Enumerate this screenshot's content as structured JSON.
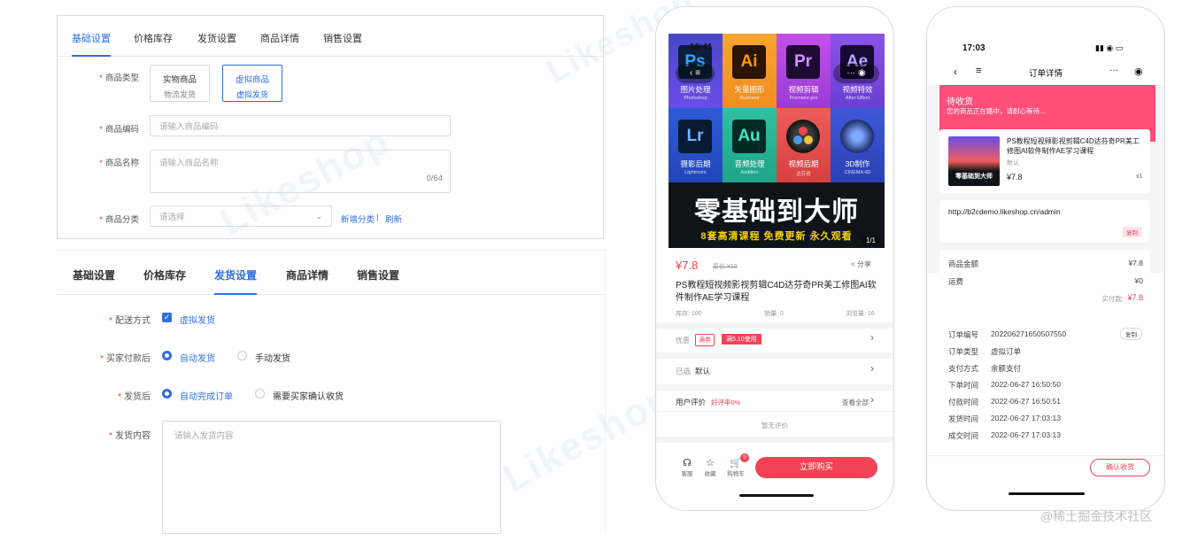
{
  "admin_top": {
    "tabs": [
      "基础设置",
      "价格库存",
      "发货设置",
      "商品详情",
      "销售设置"
    ],
    "fields": {
      "type_label": "商品类型",
      "type_options": [
        {
          "title": "实物商品",
          "sub": "物流发货"
        },
        {
          "title": "虚拟商品",
          "sub": "虚拟发货"
        }
      ],
      "code_label": "商品编码",
      "code_placeholder": "请输入商品编码",
      "name_label": "商品名称",
      "name_placeholder": "请输入商品名称",
      "name_count": "0/64",
      "category_label": "商品分类",
      "category_placeholder": "请选择",
      "add_category": "新增分类",
      "separator": "|",
      "refresh": "刷新"
    }
  },
  "admin_bottom": {
    "tabs": [
      "基础设置",
      "价格库存",
      "发货设置",
      "商品详情",
      "销售设置"
    ],
    "fields": {
      "delivery_label": "配送方式",
      "delivery_option": "虚拟发货",
      "after_pay_label": "买家付款后",
      "after_pay_options": [
        "自动发货",
        "手动发货"
      ],
      "after_ship_label": "发货后",
      "after_ship_options": [
        "自动完成订单",
        "需要买家确认收货"
      ],
      "content_label": "发货内容",
      "content_placeholder": "请输入发货内容"
    }
  },
  "watermark": "Likeshop",
  "phone1": {
    "status_time": "16:41",
    "grid": [
      {
        "abbr": "Ps",
        "title": "图片处理",
        "sub": "Photoshop"
      },
      {
        "abbr": "Ai",
        "title": "矢量图形",
        "sub": "Illustrator"
      },
      {
        "abbr": "Pr",
        "title": "视频剪辑",
        "sub": "Premiere pro"
      },
      {
        "abbr": "Ae",
        "title": "视频特效",
        "sub": "After Effect"
      },
      {
        "abbr": "Lr",
        "title": "摄影后期",
        "sub": "Lightroom"
      },
      {
        "abbr": "Au",
        "title": "音频处理",
        "sub": "Audition"
      },
      {
        "abbr": "",
        "title": "视频后期",
        "sub": "达芬奇"
      },
      {
        "abbr": "",
        "title": "3D制作",
        "sub": "CINEMA 4D"
      }
    ],
    "banner_title": "零基础到大师",
    "banner_sub": "8套高清课程  免费更新  永久观看",
    "banner_page": "1/1",
    "price": "¥7.8",
    "price_orig": "原价 ¥10",
    "share": "分享",
    "product_title": "PS教程短视频影视剪辑C4D达芬奇PR美工修图AI软件制作AE学习课程",
    "stock": "库存: 100",
    "sales": "销量: 0",
    "views": "浏览量: 16",
    "promo_label": "优惠",
    "promo_tag": "满券",
    "promo_coupon": "满5.10使用",
    "selected_label": "已选",
    "selected_value": "默认",
    "review_label": "用户评价",
    "review_rate": "好评率0%",
    "review_all": "查看全部",
    "no_review": "暂无评价",
    "nav": [
      {
        "icon": "headset-icon",
        "label": "客服"
      },
      {
        "icon": "star-icon",
        "label": "收藏"
      },
      {
        "icon": "cart-icon",
        "label": "购物车"
      }
    ],
    "cart_badge": "0",
    "buy_button": "立即购买"
  },
  "phone2": {
    "status_time": "17:03",
    "title": "订单详情",
    "status_title": "待收货",
    "status_sub": "您的商品正在路中，请耐心等待...",
    "item_title": "PS教程短视频影视剪辑C4D达芬奇PR美工修图AI软件制作AE学习课程",
    "item_spec": "默认",
    "item_price": "¥7.8",
    "item_qty": "x1",
    "item_thumb_text": "零基础到大师",
    "link": "http://b2cdemo.likeshop.cn/admin",
    "copy_btn": "复制",
    "goods_total_label": "商品金额",
    "goods_total": "¥7.8",
    "freight_label": "运费",
    "freight": "¥0",
    "paid_label": "实付款:",
    "paid": "¥7.8",
    "order_rows": [
      {
        "label": "订单编号",
        "value": "202206271650507550"
      },
      {
        "label": "订单类型",
        "value": "虚拟订单"
      },
      {
        "label": "支付方式",
        "value": "余额支付"
      },
      {
        "label": "下单时间",
        "value": "2022-06-27 16:50:50"
      },
      {
        "label": "付款时间",
        "value": "2022-06-27 16:50:51"
      },
      {
        "label": "发货时间",
        "value": "2022-06-27 17:03:13"
      },
      {
        "label": "成交时间",
        "value": "2022-06-27 17:03:13"
      }
    ],
    "copy_btn2": "复制",
    "confirm_button": "确认收货"
  },
  "credit": "@稀土掘金技术社区",
  "colors": {
    "accent": "#2f6fe0",
    "red": "#f04356",
    "pink": "#ff4f79"
  }
}
